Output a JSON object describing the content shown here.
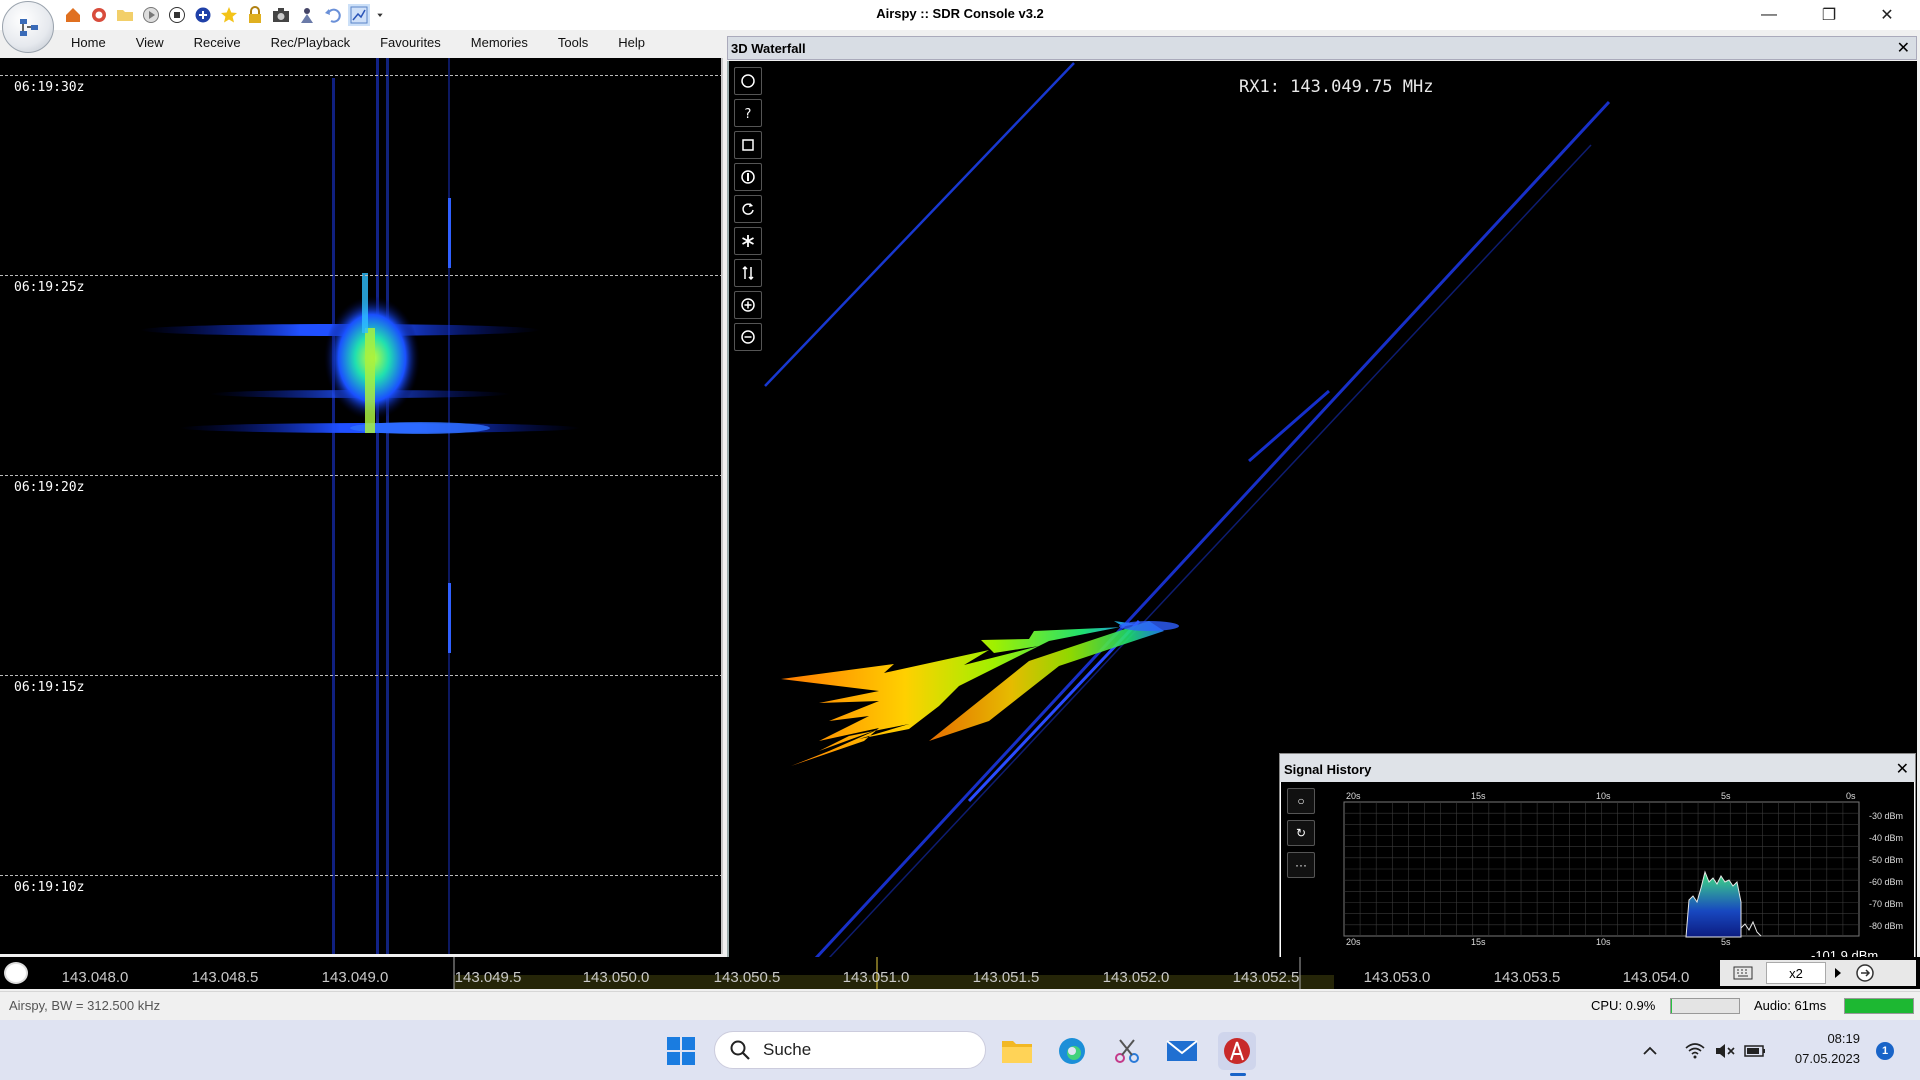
{
  "window": {
    "title": "Airspy :: SDR Console v3.2",
    "minimize_label": "—",
    "restore_label": "❐",
    "close_label": "✕"
  },
  "quick_toolbar": {
    "icons": [
      "home-icon",
      "help-ring-icon",
      "folder-icon",
      "play-icon",
      "stop-icon",
      "plus-icon",
      "star-icon",
      "lock-icon",
      "camera-icon",
      "person-icon",
      "undo-icon",
      "chart-icon",
      "dropdown-arrow-icon"
    ]
  },
  "menu": {
    "items": [
      "Home",
      "View",
      "Receive",
      "Rec/Playback",
      "Favourites",
      "Memories",
      "Tools",
      "Help"
    ]
  },
  "left_waterfall": {
    "time_marks": [
      "06:19:30z",
      "06:19:25z",
      "06:19:20z",
      "06:19:15z",
      "06:19:10z"
    ]
  },
  "waterfall_3d": {
    "title": "3D Waterfall",
    "close_label": "✕",
    "rx_label": "RX1: 143.049.75 MHz",
    "tools": [
      {
        "icon": "circle-icon"
      },
      {
        "icon": "question-icon"
      },
      {
        "icon": "square-icon"
      },
      {
        "icon": "info-icon"
      },
      {
        "icon": "rotate-icon"
      },
      {
        "icon": "asterisk-icon"
      },
      {
        "icon": "swap-vertical-icon"
      },
      {
        "icon": "zoom-in-icon"
      },
      {
        "icon": "zoom-out-icon"
      }
    ]
  },
  "signal_history": {
    "title": "Signal History",
    "close_label": "✕",
    "buttons": [
      "○",
      "↻",
      "···"
    ],
    "time_labels_top": [
      "20s",
      "15s",
      "10s",
      "5s",
      "0s"
    ],
    "time_labels_bottom": [
      "20s",
      "15s",
      "10s",
      "5s"
    ],
    "db_labels": [
      "-30 dBm",
      "-40 dBm",
      "-50 dBm",
      "-60 dBm",
      "-70 dBm",
      "-80 dBm"
    ],
    "readout": "-101.9 dBm"
  },
  "frequency_scale": {
    "ticks": [
      "143.048.0",
      "143.048.5",
      "143.049.0",
      "143.049.5",
      "143.050.0",
      "143.050.5",
      "143.051.0",
      "143.051.5",
      "143.052.0",
      "143.052.5",
      "143.053.0",
      "143.053.5",
      "143.054.0"
    ],
    "zoom_label": "x2"
  },
  "status": {
    "left_text": "Airspy, BW = 312.500 kHz",
    "cpu": "CPU: 0.9%",
    "cpu_fraction": 0.009,
    "audio": "Audio: 61ms",
    "audio_fraction": 1.0
  },
  "taskbar": {
    "search_label": "Suche",
    "time": "08:19",
    "date": "07.05.2023",
    "notification_count": "1"
  },
  "colors": {
    "accent": "#1964c8",
    "waterfall_bg": "#000000",
    "signal_blue": "#2040ff",
    "status_green": "#27c340"
  }
}
